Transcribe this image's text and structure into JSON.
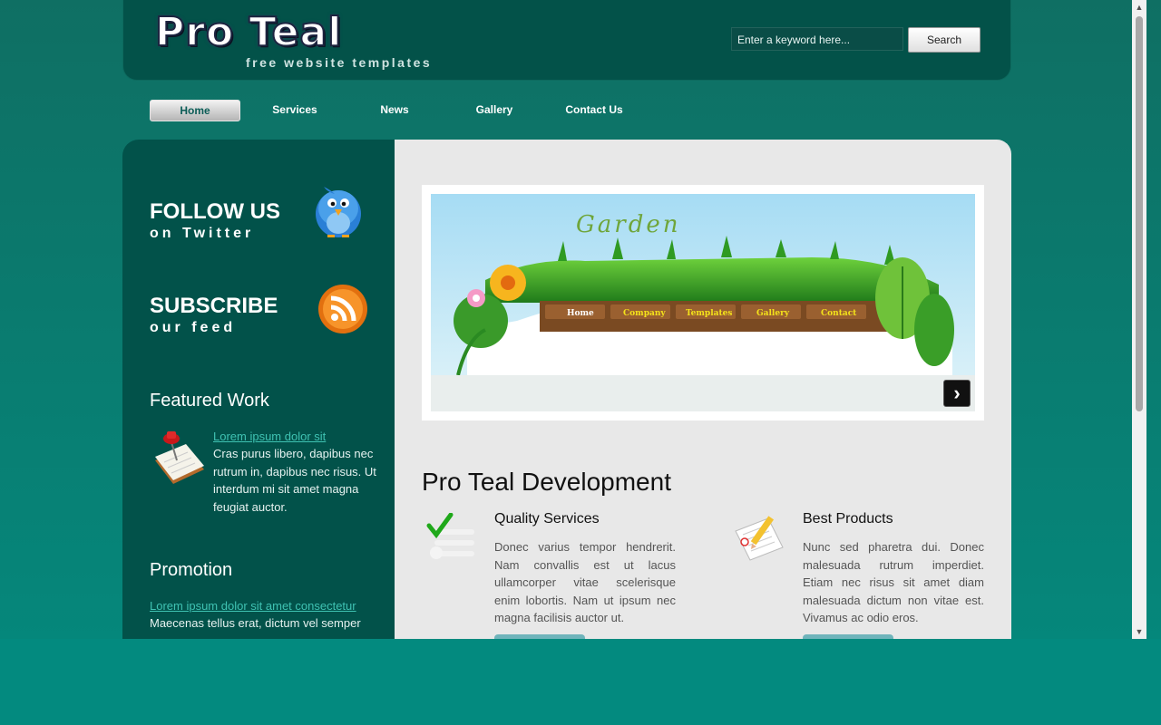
{
  "header": {
    "logo_title": "Pro Teal",
    "logo_subtitle": "free website templates",
    "search_placeholder": "Enter a keyword here...",
    "search_button": "Search"
  },
  "nav": {
    "items": [
      {
        "label": "Home",
        "active": true
      },
      {
        "label": "Services",
        "active": false
      },
      {
        "label": "News",
        "active": false
      },
      {
        "label": "Gallery",
        "active": false
      },
      {
        "label": "Contact Us",
        "active": false
      }
    ]
  },
  "sidebar": {
    "follow_title": "FOLLOW US",
    "follow_sub": "on Twitter",
    "subscribe_title": "SUBSCRIBE",
    "subscribe_sub": "our feed",
    "featured_heading": "Featured Work",
    "featured_link": "Lorem ipsum dolor sit",
    "featured_text": "Cras purus libero, dapibus nec rutrum in, dapibus nec risus. Ut interdum mi sit amet magna feugiat auctor.",
    "promotion_heading": "Promotion",
    "promotion_link": "Lorem ipsum dolor sit amet consectetur",
    "promotion_text": "Maecenas tellus erat, dictum vel semper"
  },
  "slider": {
    "slide_title": "Garden",
    "slide_nav": [
      "Home",
      "Company",
      "Templates",
      "Gallery",
      "Contact"
    ],
    "next_glyph": "›"
  },
  "main": {
    "title": "Pro Teal Development",
    "col1_title": "Quality Services",
    "col1_text": "Donec varius tempor hendrerit. Nam convallis est ut lacus ullamcorper vitae scelerisque enim lobortis. Nam ut ipsum nec magna facilisis auctor ut.",
    "col2_title": "Best Products",
    "col2_text": "Nunc sed pharetra dui. Donec malesuada rutrum imperdiet. Etiam nec risus sit amet diam malesuada dictum non vitae est. Vivamus ac odio eros."
  },
  "colors": {
    "page_bg": "#038a7f",
    "header_bg": "#035249",
    "sidebar_bg": "#02524a",
    "main_bg": "#e8e8e8",
    "link": "#3fc2b2"
  },
  "icons": [
    "twitter-bird-icon",
    "rss-feed-icon",
    "pushpin-notepad-icon",
    "checkmark-list-icon",
    "pencil-document-icon",
    "scroll-up-arrow-icon",
    "scroll-down-arrow-icon"
  ]
}
